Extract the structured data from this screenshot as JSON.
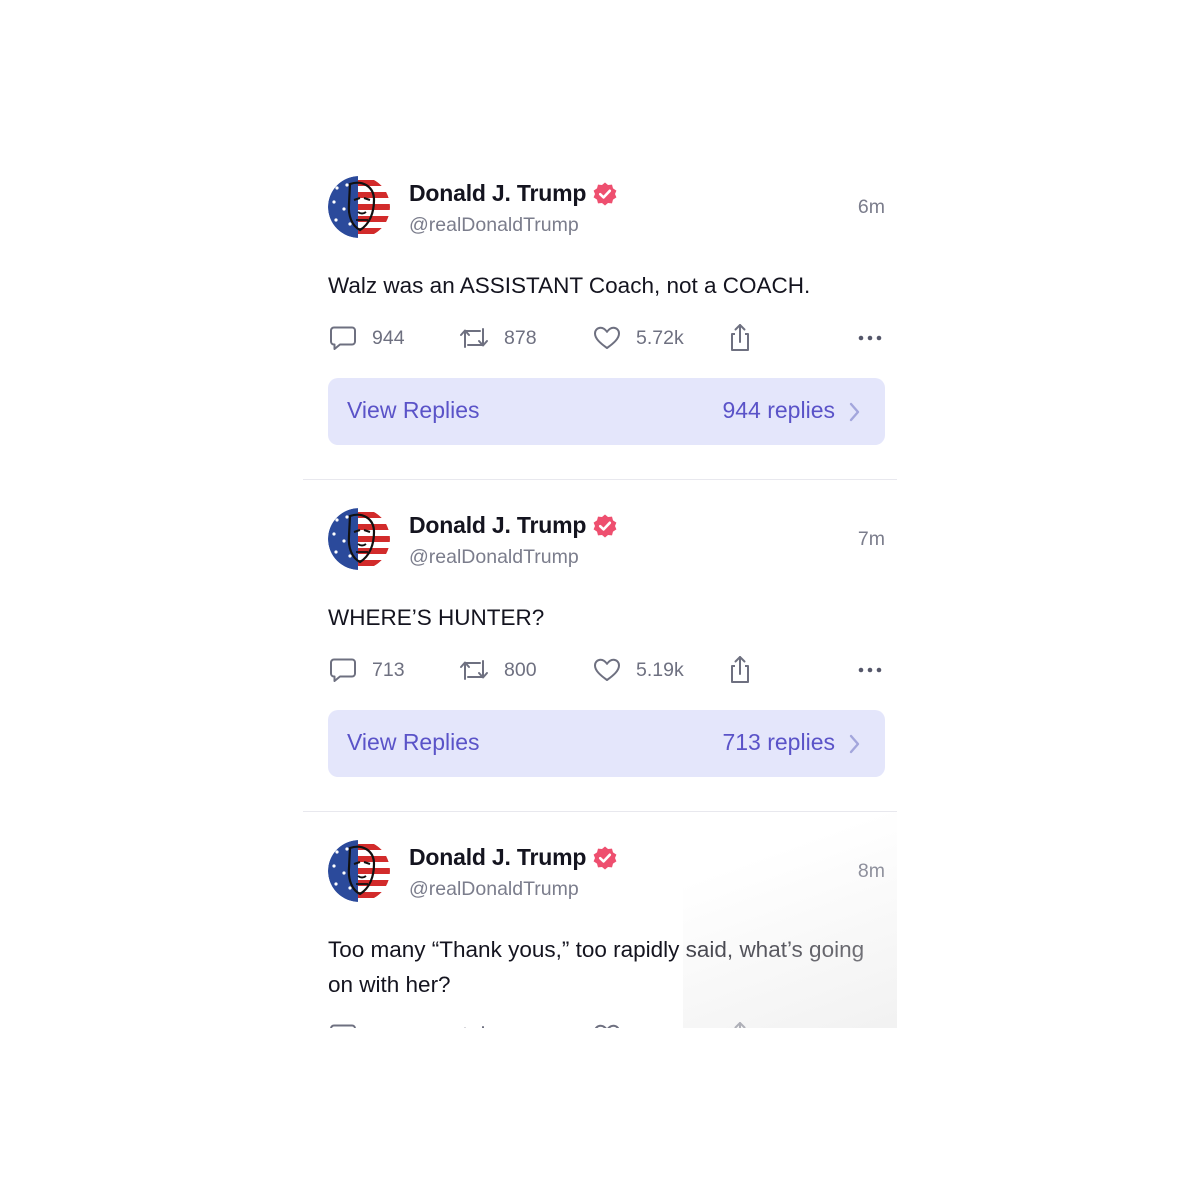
{
  "posts": [
    {
      "author": "Donald J. Trump",
      "handle": "@realDonaldTrump",
      "time": "6m",
      "text": "Walz was an ASSISTANT Coach, not a COACH.",
      "replies": "944",
      "reposts": "878",
      "likes": "5.72k",
      "view_replies_label": "View Replies",
      "view_replies_count": "944 replies"
    },
    {
      "author": "Donald J. Trump",
      "handle": "@realDonaldTrump",
      "time": "7m",
      "text": "WHERE’S HUNTER?",
      "replies": "713",
      "reposts": "800",
      "likes": "5.19k",
      "view_replies_label": "View Replies",
      "view_replies_count": "713 replies"
    },
    {
      "author": "Donald J. Trump",
      "handle": "@realDonaldTrump",
      "time": "8m",
      "text": "Too many “Thank yous,” too rapidly said, what’s going on with her?"
    }
  ],
  "icons": {
    "reply": "speech-bubble-icon",
    "repost": "repost-arrows-icon",
    "like": "heart-icon",
    "share": "share-upload-icon",
    "more": "ellipsis-icon",
    "verified": "verified-badge-icon",
    "chevron": "chevron-right-icon"
  },
  "colors": {
    "verified_badge": "#ee4f6f",
    "view_replies_bg": "#e4e6fb",
    "view_replies_text": "#5a53c8",
    "secondary_text": "#7b7d8c"
  }
}
